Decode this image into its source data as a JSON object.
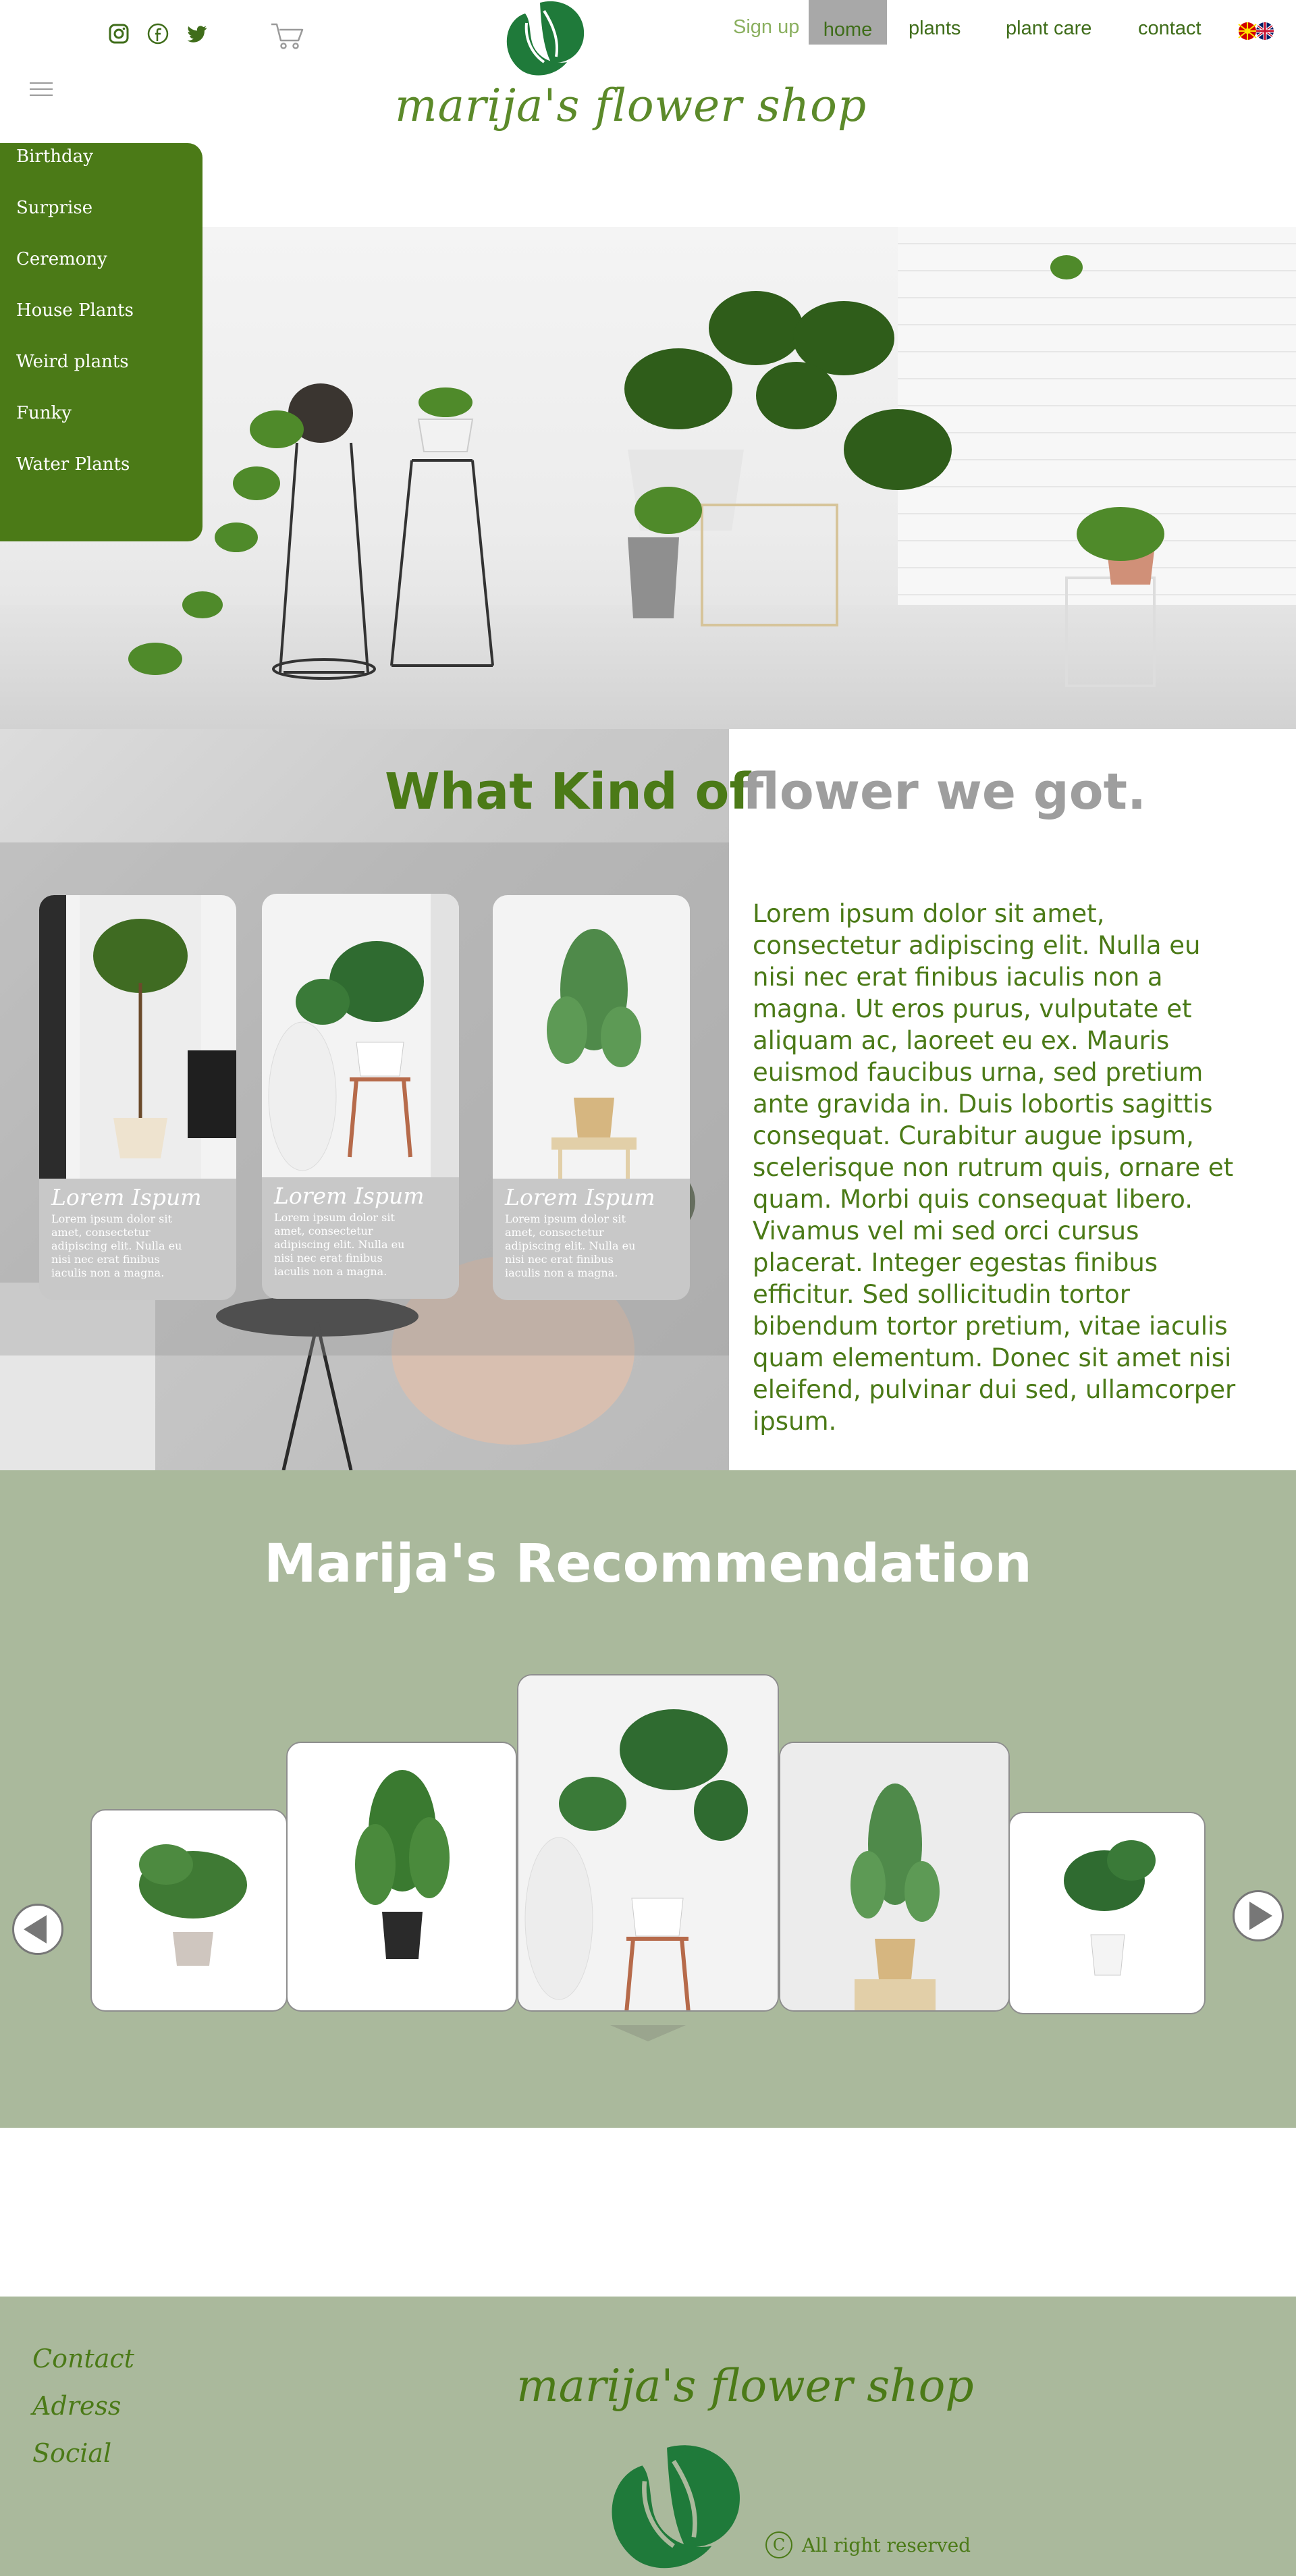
{
  "brand": {
    "name": "marija's flower shop",
    "accent_green": "#4b7a17",
    "light_green": "#5c8a2a",
    "sage": "#aab99c",
    "grey": "#9e9e9e"
  },
  "header": {
    "social_icons": [
      "instagram-icon",
      "facebook-icon",
      "twitter-icon"
    ],
    "cart_icon": "cart-icon",
    "menu_icon": "hamburger-menu-icon",
    "language_flags": [
      "macedonia-flag-icon",
      "uk-flag-icon"
    ]
  },
  "nav": {
    "signup": "Sign up",
    "home": "home",
    "plants": "plants",
    "plant_care": "plant care",
    "contact": "contact"
  },
  "side_menu": {
    "items": [
      "Birthday",
      "Surprise",
      "Ceremony",
      "House Plants",
      "Weird plants",
      "Funky",
      "Water Plants"
    ]
  },
  "kinds": {
    "title_part1": "What Kind of",
    "title_part2": "flower we got.",
    "description": "Lorem ipsum dolor sit amet, consectetur adipiscing elit. Nulla eu nisi nec erat finibus iaculis non a magna. Ut eros purus, vulputate et aliquam ac, laoreet eu ex. Mauris euismod faucibus urna, sed pretium ante gravida in. Duis lobortis sagittis consequat. Curabitur augue ipsum, scelerisque non rutrum quis, ornare et quam. Morbi quis consequat libero. Vivamus vel mi sed orci cursus placerat. Integer egestas finibus efficitur. Sed sollicitudin tortor bibendum tortor pretium, vitae iaculis quam elementum. Donec sit amet nisi eleifend, pulvinar dui sed, ullamcorper ipsum.",
    "cards": [
      {
        "title": "Lorem Ispum",
        "text": "Lorem ipsum dolor sit amet, consectetur adipiscing elit. Nulla eu nisi nec erat finibus iaculis non a magna."
      },
      {
        "title": "Lorem Ispum",
        "text": "Lorem ipsum dolor sit amet, consectetur adipiscing elit. Nulla eu nisi nec erat finibus iaculis non a magna."
      },
      {
        "title": "Lorem Ispum",
        "text": "Lorem ipsum dolor sit amet, consectetur adipiscing elit. Nulla eu nisi nec erat finibus iaculis non a magna."
      }
    ]
  },
  "recommendation": {
    "title": "Marija's Recommendation",
    "prev_icon": "arrow-left-icon",
    "next_icon": "arrow-right-icon"
  },
  "footer": {
    "links": [
      "Contact",
      "Adress",
      "Social"
    ],
    "logo_text": "marija's flower shop",
    "copyright_symbol": "C",
    "copyright_text": "All right reserved"
  }
}
